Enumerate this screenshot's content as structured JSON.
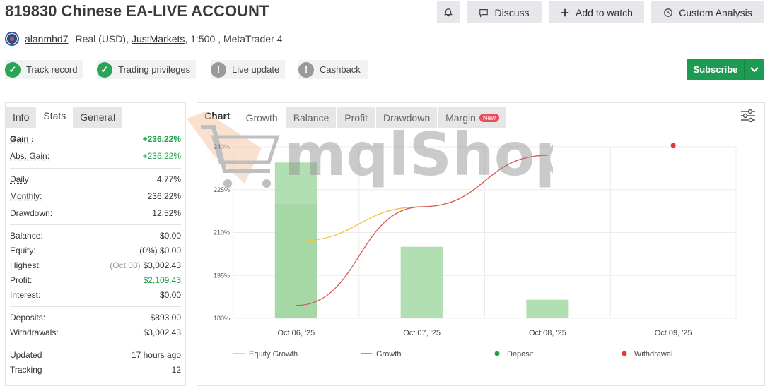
{
  "header": {
    "title": "819830 Chinese EA-LIVE ACCOUNT",
    "discuss": "Discuss",
    "add_watch": "Add to watch",
    "custom_analysis": "Custom Analysis"
  },
  "account": {
    "user": "alanmhd7",
    "type": "Real (USD),",
    "broker": "JustMarkets",
    "leverage": ", 1:500 , MetaTrader 4"
  },
  "badges": [
    "Track record",
    "Trading privileges",
    "Live update",
    "Cashback"
  ],
  "subscribe": "Subscribe",
  "stats_tabs": [
    "Info",
    "Stats",
    "General"
  ],
  "stats": {
    "gain_label": "Gain :",
    "gain": "+236.22%",
    "abs_gain_label": "Abs. Gain:",
    "abs_gain": "+236.22%",
    "daily_label": "Daily",
    "daily": "4.77%",
    "monthly_label": "Monthly:",
    "monthly": "236.22%",
    "drawdown_label": "Drawdown:",
    "drawdown": "12.52%",
    "balance_label": "Balance:",
    "balance": "$0.00",
    "equity_label": "Equity:",
    "equity": "(0%) $0.00",
    "highest_label": "Highest:",
    "highest_date": "(Oct 08)",
    "highest": "$3,002.43",
    "profit_label": "Profit:",
    "profit": "$2,109.43",
    "interest_label": "Interest:",
    "interest": "$0.00",
    "deposits_label": "Deposits:",
    "deposits": "$893.00",
    "withdrawals_label": "Withdrawals:",
    "withdrawals": "$3,002.43",
    "updated_label": "Updated",
    "updated": "17 hours ago",
    "tracking_label": "Tracking",
    "tracking": "12"
  },
  "chart_tabs": [
    "Chart",
    "Growth",
    "Balance",
    "Profit",
    "Drawdown",
    "Margin"
  ],
  "new_label": "New",
  "watermark": "mqlShop",
  "chart_data": {
    "type": "bar",
    "categories": [
      "Oct 06, '25",
      "Oct 07, '25",
      "Oct 08, '25",
      "Oct 09, '25"
    ],
    "y_ticks": [
      "180%",
      "195%",
      "210%",
      "225%",
      "240%"
    ],
    "ylim": [
      180,
      240
    ],
    "bars": [
      {
        "x": 0,
        "value": 234.5,
        "inner": 220
      },
      {
        "x": 1,
        "value": 205
      },
      {
        "x": 2,
        "value": 186.5
      }
    ],
    "series": [
      {
        "name": "Equity Growth",
        "color": "#f2c23a",
        "points": [
          [
            0,
            207
          ],
          [
            1,
            219
          ],
          [
            2,
            237
          ]
        ]
      },
      {
        "name": "Growth",
        "color": "#d9585c",
        "points": [
          [
            0,
            184.5
          ],
          [
            1,
            219
          ],
          [
            2,
            237
          ]
        ]
      },
      {
        "name": "Deposit",
        "color": "#22a04e",
        "points": []
      },
      {
        "name": "Withdrawal",
        "color": "#e03b3b",
        "points": [
          [
            3,
            240.5
          ]
        ]
      }
    ],
    "grid": true,
    "legend": "bottom"
  }
}
